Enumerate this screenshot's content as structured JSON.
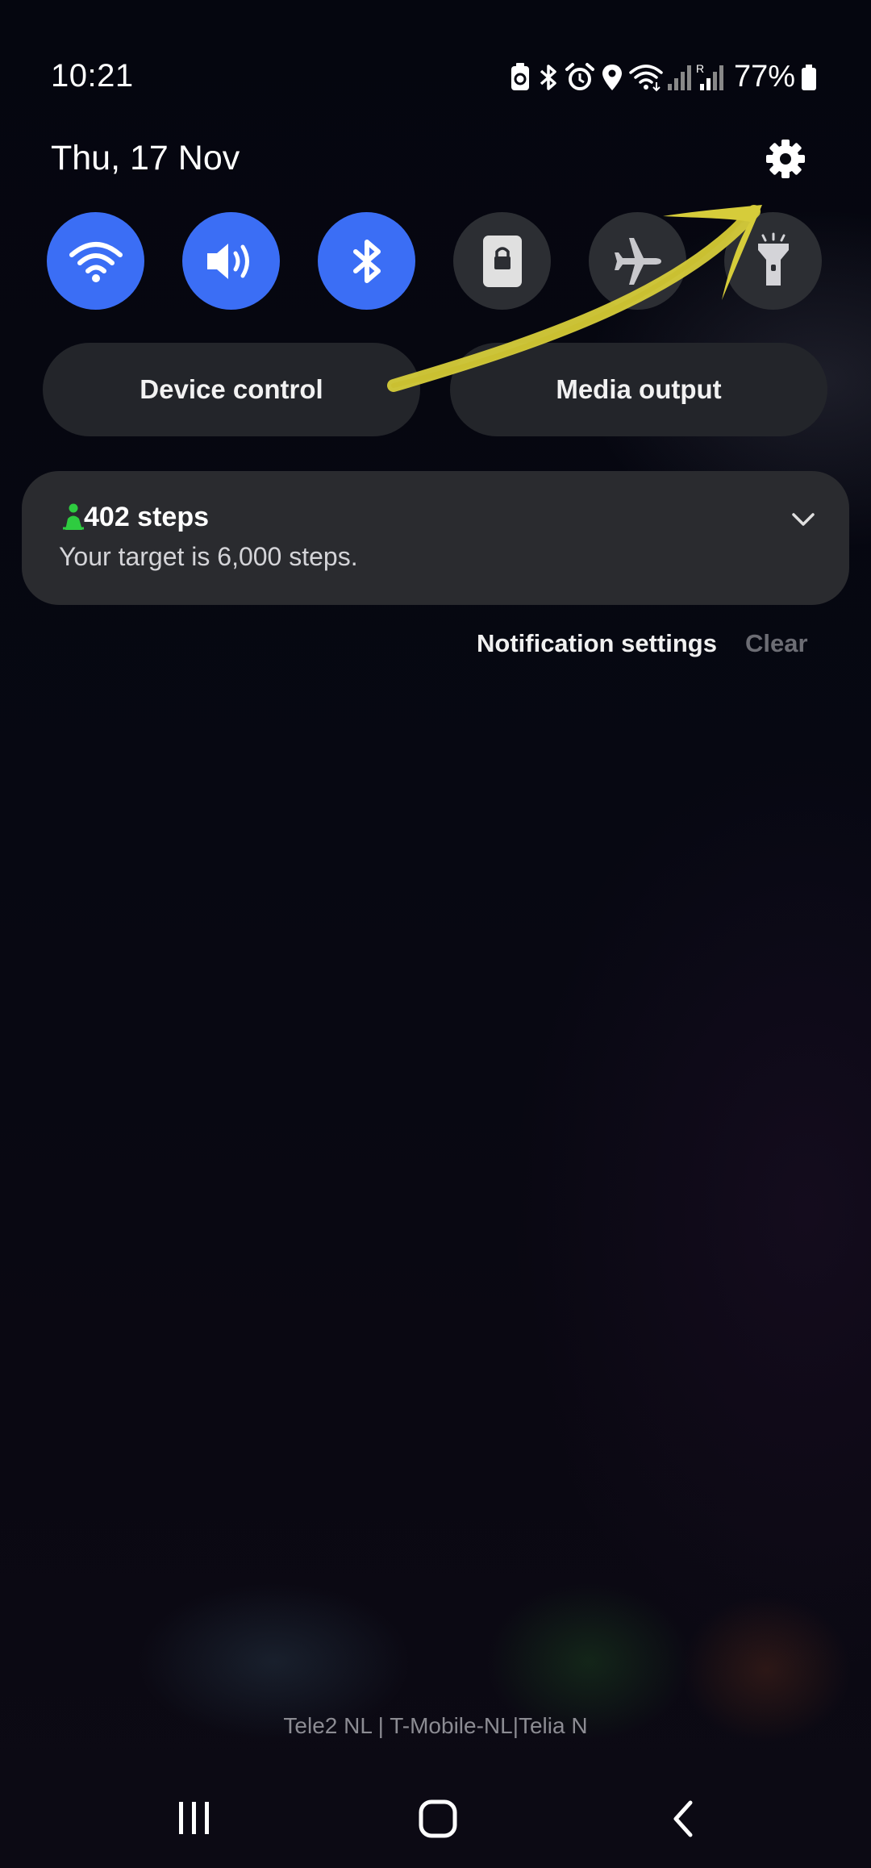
{
  "status_bar": {
    "time": "10:21",
    "battery_percent": "77%",
    "icons": [
      "battery-saver-icon",
      "bluetooth-icon",
      "alarm-icon",
      "location-icon",
      "wifi-icon",
      "signal-icon",
      "roaming-signal-icon",
      "battery-icon"
    ]
  },
  "header": {
    "date": "Thu, 17 Nov",
    "settings_icon": "gear-icon"
  },
  "quick_toggles": [
    {
      "name": "wifi",
      "icon": "wifi-icon",
      "state": "on"
    },
    {
      "name": "sound",
      "icon": "speaker-icon",
      "state": "on"
    },
    {
      "name": "bluetooth",
      "icon": "bluetooth-icon",
      "state": "on"
    },
    {
      "name": "lock",
      "icon": "lock-icon",
      "state": "off"
    },
    {
      "name": "airplane",
      "icon": "airplane-icon",
      "state": "off"
    },
    {
      "name": "flashlight",
      "icon": "flashlight-icon",
      "state": "off"
    }
  ],
  "panels": {
    "device_control": "Device control",
    "media_output": "Media output"
  },
  "notification": {
    "title": "402 steps",
    "body": "Your target is 6,000 steps.",
    "app_icon": "walking-person-icon"
  },
  "notification_actions": {
    "settings": "Notification settings",
    "clear": "Clear"
  },
  "carrier_text": "Tele2 NL | T-Mobile-NL|Telia N",
  "colors": {
    "toggle_on": "#3b6ef5",
    "toggle_off": "#2c2e33",
    "annotation_arrow": "#d6cc3a",
    "steps_icon": "#2ecc40"
  },
  "nav_bar": [
    "recents-icon",
    "home-icon",
    "back-icon"
  ]
}
